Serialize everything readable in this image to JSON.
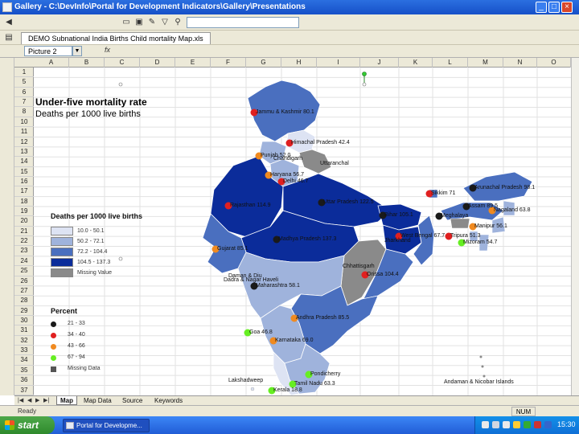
{
  "window": {
    "title": "Gallery - C:\\DevInfo\\Portal for Development Indicators\\Gallery\\Presentations",
    "buttons": {
      "minimize": "_",
      "maximize": "□",
      "close": "×"
    }
  },
  "document_tab": {
    "label": "DEMO Subnational India  Births  Child mortality   Map.xls"
  },
  "namebox": {
    "value": "Picture 2",
    "fx": "fx"
  },
  "columns": [
    "A",
    "B",
    "C",
    "D",
    "E",
    "F",
    "G",
    "H",
    "I",
    "J",
    "K",
    "L",
    "M",
    "N",
    "O"
  ],
  "rows": [
    "1",
    "5",
    "6",
    "7",
    "8",
    "10",
    "11",
    "12",
    "13",
    "14",
    "15",
    "16",
    "17",
    "18",
    "19",
    "20",
    "21",
    "22",
    "23",
    "24",
    "25",
    "26",
    "27",
    "28",
    "29",
    "30",
    "31",
    "32",
    "33",
    "34",
    "35",
    "36",
    "37"
  ],
  "map": {
    "title": "Under-five mortality rate",
    "subtitle": "Deaths per 1000 live births",
    "fill_legend": {
      "title": "Deaths per 1000 live births",
      "items": [
        {
          "label": "10.0 - 50.1",
          "color": "#dde3f3"
        },
        {
          "label": "50.2 - 72.1",
          "color": "#9fb3dc"
        },
        {
          "label": "72.2 - 104.4",
          "color": "#4a6fbf"
        },
        {
          "label": "104.5 - 137.3",
          "color": "#0b2c9a"
        },
        {
          "label": "Missing Value",
          "color": "#8a8a8a"
        }
      ]
    },
    "dot_legend": {
      "title": "Percent",
      "items": [
        {
          "label": "21 - 33",
          "color": "#1a1a1a",
          "shape": "circle"
        },
        {
          "label": "34 - 40",
          "color": "#e02020",
          "shape": "circle"
        },
        {
          "label": "43 - 66",
          "color": "#f08a20",
          "shape": "circle"
        },
        {
          "label": "67 - 94",
          "color": "#66ee22",
          "shape": "circle"
        },
        {
          "label": "Missing Data",
          "color": "#555555",
          "shape": "square"
        }
      ]
    },
    "state_labels": [
      {
        "text": "Jammu & Kashmir  80.1"
      },
      {
        "text": "Himachal Pradesh  42.4"
      },
      {
        "text": "Punjab  52.0"
      },
      {
        "text": "Chandigarh"
      },
      {
        "text": "Uttaranchal"
      },
      {
        "text": "Haryana  56.7"
      },
      {
        "text": "Delhi  46.7"
      },
      {
        "text": "Rajasthan  114.9"
      },
      {
        "text": "Uttar Pradesh  122.5"
      },
      {
        "text": "Bihar  105.1"
      },
      {
        "text": "Sikkim  71"
      },
      {
        "text": "Arunachal Pradesh  98.1"
      },
      {
        "text": "Assam  89.5"
      },
      {
        "text": "Nagaland  63.8"
      },
      {
        "text": "Meghalaya"
      },
      {
        "text": "Manipur  56.1"
      },
      {
        "text": "West Bengal  67.7"
      },
      {
        "text": "Tripura  51.3"
      },
      {
        "text": "Mizoram  54.7"
      },
      {
        "text": "Jharkhand"
      },
      {
        "text": "Madhya Pradesh  137.3"
      },
      {
        "text": "Gujarat  85.1"
      },
      {
        "text": "Chhattisgarh"
      },
      {
        "text": "Orissa  104.4"
      },
      {
        "text": "Daman & Diu"
      },
      {
        "text": "Dadra & Nagar Haveli"
      },
      {
        "text": "Maharashtra  58.1"
      },
      {
        "text": "Andhra Pradesh  85.5"
      },
      {
        "text": "Goa  46.8"
      },
      {
        "text": "Karnataka  69.0"
      },
      {
        "text": "Lakshadweep"
      },
      {
        "text": "Pondicherry"
      },
      {
        "text": "Tamil Nadu  63.3"
      },
      {
        "text": "Kerala  18.8"
      },
      {
        "text": "Andaman & Nicobar Islands"
      }
    ]
  },
  "sheet_tabs": [
    "Map",
    "Map Data",
    "Source",
    "Keywords"
  ],
  "status": {
    "text": "Ready",
    "num": "NUM"
  },
  "taskbar": {
    "start": "start",
    "window": "Portal for Developme...",
    "clock": "15:30"
  }
}
